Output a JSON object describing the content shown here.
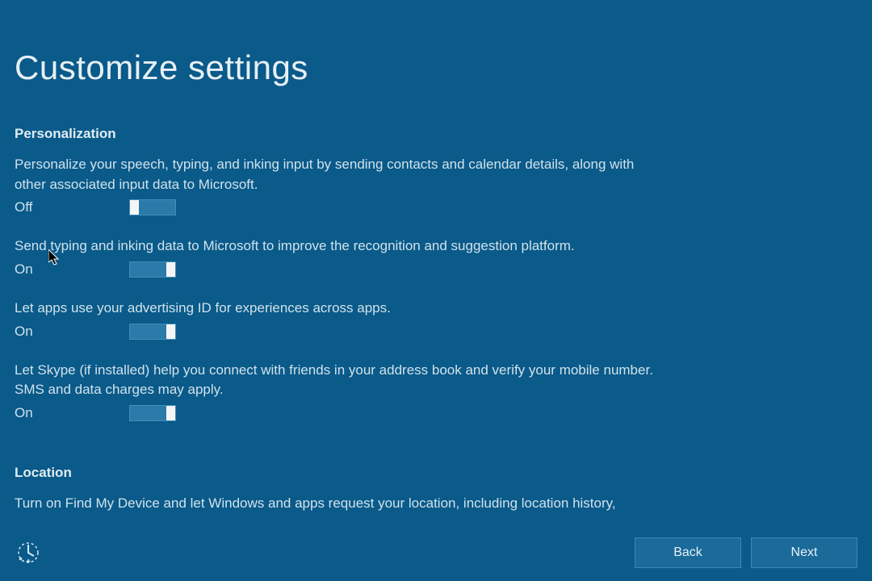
{
  "title": "Customize settings",
  "sections": {
    "personalization": {
      "header": "Personalization",
      "items": [
        {
          "desc": "Personalize your speech, typing, and inking input by sending contacts and calendar details, along with other associated input data to Microsoft.",
          "state": "Off",
          "on": false
        },
        {
          "desc": "Send typing and inking data to Microsoft to improve the recognition and suggestion platform.",
          "state": "On",
          "on": true
        },
        {
          "desc": "Let apps use your advertising ID for experiences across apps.",
          "state": "On",
          "on": true
        },
        {
          "desc": "Let Skype (if installed) help you connect with friends in your address book and verify your mobile number. SMS and data charges may apply.",
          "state": "On",
          "on": true
        }
      ]
    },
    "location": {
      "header": "Location",
      "desc": "Turn on Find My Device and let Windows and apps request your location, including location history,"
    }
  },
  "footer": {
    "back": "Back",
    "next": "Next"
  }
}
